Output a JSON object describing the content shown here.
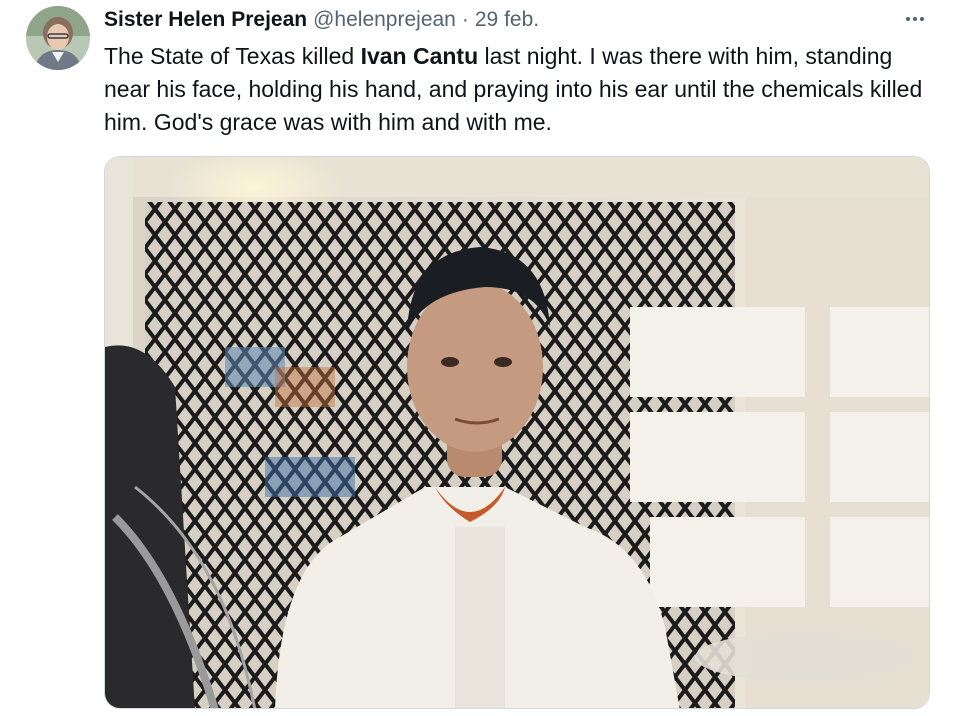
{
  "tweet": {
    "author": {
      "name": "Sister Helen Prejean",
      "handle": "@helenprejean",
      "separator": "·",
      "date": "29 feb."
    },
    "text": {
      "before": "The State of Texas killed ",
      "bold": "Ivan Cantu",
      "after": " last night. I was there with him, standing near his face, holding his hand, and praying into his ear until the chemicals killed him. God's grace was with him and with me."
    },
    "more_icon": "more-horizontal-icon",
    "media": {
      "type": "photo",
      "description_icon": "photo"
    }
  },
  "colors": {
    "text": "#0f1419",
    "secondary": "#536471",
    "border": "#cfd9de"
  }
}
